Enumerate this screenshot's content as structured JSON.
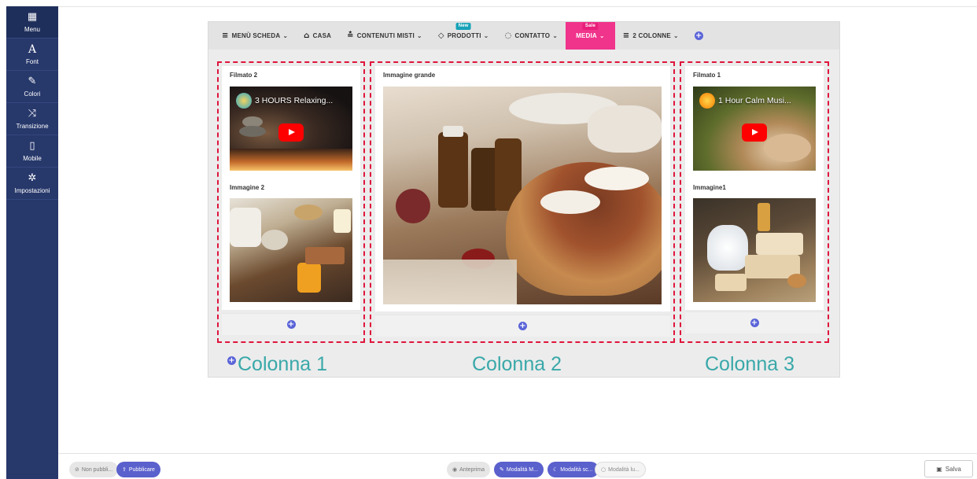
{
  "sidebar": {
    "items": [
      {
        "icon": "grid-icon",
        "glyph": "▦",
        "label": "Menu"
      },
      {
        "icon": "font-icon",
        "glyph": "A",
        "label": "Font"
      },
      {
        "icon": "brush-icon",
        "glyph": "✎",
        "label": "Colori"
      },
      {
        "icon": "shuffle-icon",
        "glyph": "⤨",
        "label": "Transizione"
      },
      {
        "icon": "mobile-icon",
        "glyph": "▯",
        "label": "Mobile"
      },
      {
        "icon": "gear-icon",
        "glyph": "✲",
        "label": "Impostazioni"
      }
    ]
  },
  "menu": {
    "items": [
      {
        "icon": "bars-icon",
        "glyph": "≡",
        "label": "MENÙ SCHEDA"
      },
      {
        "icon": "home-icon",
        "glyph": "⌂",
        "label": "CASA"
      },
      {
        "icon": "sitemap-icon",
        "glyph": "≛",
        "label": "CONTENUTI MISTI"
      },
      {
        "icon": "diamond-icon",
        "glyph": "◇",
        "label": "PRODOTTI",
        "badge": "New"
      },
      {
        "icon": "comment-icon",
        "glyph": "◌",
        "label": "CONTATTO"
      },
      {
        "label": "MEDIA",
        "badge": "Sale"
      },
      {
        "icon": "bars-icon",
        "glyph": "≡",
        "label": "2 COLONNE"
      }
    ],
    "add_glyph": "+"
  },
  "columns": [
    {
      "label": "Colonna 1",
      "video_title": "Filmato 2",
      "video_caption": "3 HOURS Relaxing...",
      "image_title": "Immagine 2"
    },
    {
      "label": "Colonna 2",
      "image_title": "Immagine grande"
    },
    {
      "label": "Colonna 3",
      "video_title": "Filmato 1",
      "video_caption": "1 Hour Calm Musi...",
      "image_title": "Immagine1"
    }
  ],
  "bottom": {
    "not_published": "Non pubbli...",
    "publish": "Pubblicare",
    "preview": "Anteprima",
    "mode_edit": "Modalità M...",
    "mode_dark": "Modalità sc...",
    "mode_light": "Modalità lu...",
    "save": "Salva"
  },
  "colors": {
    "sidebar": "#27386b",
    "accent": "#5a60cc",
    "media_tab": "#f0338b",
    "column_outline": "#e0143c",
    "column_label": "#3aa8a9"
  }
}
